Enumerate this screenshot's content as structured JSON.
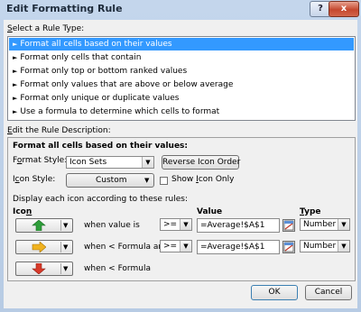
{
  "window": {
    "title": "Edit Formatting Rule",
    "help_label": "?",
    "close_label": "x"
  },
  "rule_type": {
    "label_pre": "",
    "label_key": "S",
    "label_post": "elect a Rule Type:",
    "items": [
      "Format all cells based on their values",
      "Format only cells that contain",
      "Format only top or bottom ranked values",
      "Format only values that are above or below average",
      "Format only unique or duplicate values",
      "Use a formula to determine which cells to format"
    ],
    "selected_index": 0
  },
  "description": {
    "label_pre": "",
    "label_key": "E",
    "label_post": "dit the Rule Description:",
    "heading": "Format all cells based on their values:",
    "format_style": {
      "label_pre": "F",
      "label_key": "o",
      "label_post": "rmat Style:",
      "value": "Icon Sets"
    },
    "reverse_button": "Reverse Icon Order",
    "icon_style": {
      "label_pre": "I",
      "label_key": "c",
      "label_post": "on Style:",
      "value": "Custom"
    },
    "show_icon_only": {
      "label_pre": "Show ",
      "label_key": "I",
      "label_post": "con Only",
      "checked": false
    },
    "display_text": "Display each icon according to these rules:",
    "columns": {
      "icon_pre": "Ico",
      "icon_key": "n",
      "icon_post": "",
      "value": "Value",
      "type_pre": "",
      "type_key": "T",
      "type_post": "ype"
    },
    "rules": [
      {
        "icon": "green-up-arrow",
        "color": "#2e9e3a",
        "condition": "when value is",
        "operator": ">=",
        "value": "=Average!$A$1",
        "type": "Number"
      },
      {
        "icon": "yellow-right-arrow",
        "color": "#f0b21f",
        "condition": "when < Formula and",
        "operator": ">=",
        "value": "=Average!$A$1",
        "type": "Number"
      },
      {
        "icon": "red-down-arrow",
        "color": "#d83a2a",
        "condition": "when < Formula"
      }
    ]
  },
  "footer": {
    "ok_label": "OK",
    "cancel_label": "Cancel"
  }
}
